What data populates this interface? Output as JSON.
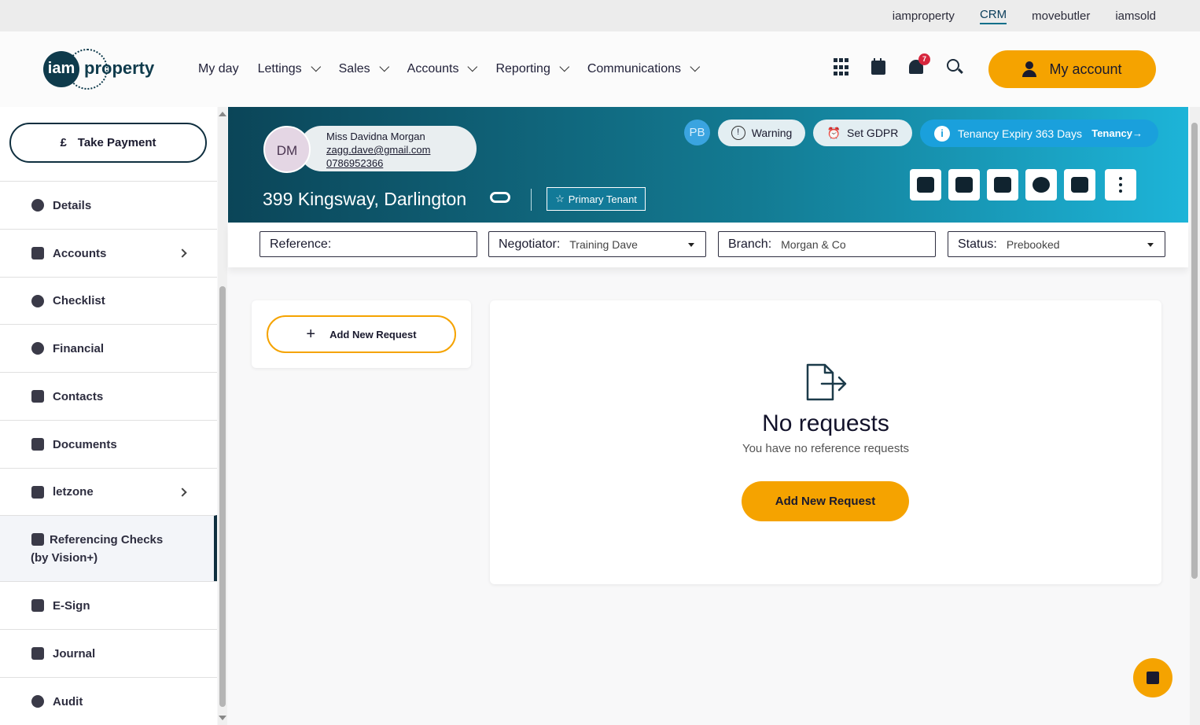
{
  "topbar": {
    "links": [
      "iamproperty",
      "CRM",
      "movebutler",
      "iamsold"
    ],
    "active": "CRM"
  },
  "header": {
    "logo_text": "iam property",
    "nav": [
      "My day",
      "Lettings",
      "Sales",
      "Accounts",
      "Reporting",
      "Communications"
    ],
    "notification_count": "7",
    "my_account_label": "My account"
  },
  "sidebar": {
    "take_payment": "Take Payment",
    "currency_symbol": "£",
    "items": [
      {
        "label": "Details"
      },
      {
        "label": "Accounts"
      },
      {
        "label": "Checklist"
      },
      {
        "label": "Financial"
      },
      {
        "label": "Contacts"
      },
      {
        "label": "Documents"
      },
      {
        "label": "letzone"
      },
      {
        "label": "Referencing Checks",
        "label2": "(by Vision+)"
      },
      {
        "label": "E-Sign"
      },
      {
        "label": "Journal"
      },
      {
        "label": "Audit"
      }
    ]
  },
  "banner": {
    "initials": "DM",
    "name": "Miss Davidna Morgan",
    "email": "zagg.dave@gmail.com",
    "phone": "0786952366",
    "address": "399 Kingsway, Darlington",
    "primary_tenant": "Primary Tenant",
    "pb": "PB",
    "warning": "Warning",
    "set_gdpr": "Set GDPR",
    "tenancy_expiry": "Tenancy Expiry 363 Days",
    "tenancy_link": "Tenancy→",
    "info_glyph": "i",
    "warning_glyph": "!"
  },
  "fields": {
    "reference_label": "Reference:",
    "reference_value": "",
    "negotiator_label": "Negotiator:",
    "negotiator_value": "Training Dave",
    "branch_label": "Branch:",
    "branch_value": "Morgan & Co",
    "status_label": "Status:",
    "status_value": "Prebooked"
  },
  "content": {
    "add_new_request": "Add New Request",
    "no_requests_title": "No requests",
    "no_requests_subtitle": "You have no reference requests",
    "add_new_request_primary": "Add New Request"
  },
  "colors": {
    "accent": "#f5a300",
    "banner_dark": "#0b4558",
    "banner_light": "#1db4d8",
    "navy": "#0f2f3f"
  }
}
